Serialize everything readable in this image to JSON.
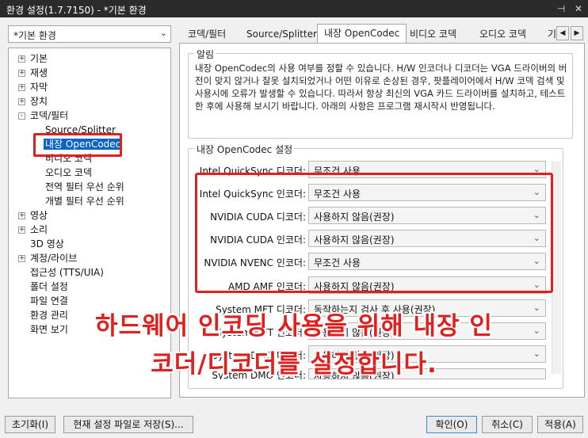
{
  "window": {
    "title": "환경 설정(1.7.7150) - *기본 환경",
    "pin_icon": "pin-icon",
    "close_icon": "close-icon"
  },
  "profile": {
    "selected": "*기본 환경"
  },
  "tree": {
    "items": [
      {
        "label": "기본",
        "expander": "+"
      },
      {
        "label": "재생",
        "expander": "+"
      },
      {
        "label": "자막",
        "expander": "+"
      },
      {
        "label": "장치",
        "expander": "+"
      },
      {
        "label": "코덱/필터",
        "expander": "-"
      },
      {
        "label": "Source/Splitter"
      },
      {
        "label": "내장 OpenCodec"
      },
      {
        "label": "비디오 코덱"
      },
      {
        "label": "오디오 코덱"
      },
      {
        "label": "전역 필터 우선 순위"
      },
      {
        "label": "개별 필터 우선 순위"
      },
      {
        "label": "영상",
        "expander": "+"
      },
      {
        "label": "소리",
        "expander": "+"
      },
      {
        "label": "3D 영상"
      },
      {
        "label": "계정/라이브",
        "expander": "+"
      },
      {
        "label": "접근성 (TTS/UIA)"
      },
      {
        "label": "폴더 설정"
      },
      {
        "label": "파일 연결"
      },
      {
        "label": "환경 관리"
      },
      {
        "label": "화면 보기"
      }
    ]
  },
  "tabs": [
    "코덱/필터",
    "Source/Splitter",
    "내장 OpenCodec",
    "비디오 코덱",
    "오디오 코덱",
    "기"
  ],
  "active_tab": "내장 OpenCodec",
  "notice": {
    "title": "알림",
    "text": "내장 OpenCodec의 사용 여부를 정할 수 있습니다. H/W 인코더나 디코더는 VGA 드라이버의 버전이 맞지 않거나 잘못 설치되었거나 어떤 이유로 손상된 경우, 팟플레이어에서 H/W 코덱 검색 및 사용시에 오류가 발생할 수 있습니다. 따라서 항상 최신의 VGA 카드 드라이버를 설치하고, 테스트한 후에 사용해 보시기 바랍니다. 아래의 사항은 프로그램 재시작시 반영됩니다."
  },
  "codec_settings": {
    "title": "내장 OpenCodec 설정",
    "rows": [
      {
        "label": "Intel QuickSync 디코더:",
        "value": "무조건 사용"
      },
      {
        "label": "Intel QuickSync 인코더:",
        "value": "무조건 사용"
      },
      {
        "label": "NVIDIA CUDA 디코더:",
        "value": "사용하지 않음(권장)"
      },
      {
        "label": "NVIDIA CUDA 인코더:",
        "value": "사용하지 않음(권장)"
      },
      {
        "label": "NVIDIA NVENC 인코더:",
        "value": "무조건 사용"
      },
      {
        "label": "AMD AMF 인코더:",
        "value": "사용하지 않음(권장)"
      },
      {
        "label": "System MFT 디코더:",
        "value": "동작하는지 검사 후 사용(권장)"
      },
      {
        "label": "System MFT 인코더:",
        "value": "사용하지 않음(권장)"
      },
      {
        "label": "System DMO 디코더:",
        "value": "사용하지 않음(권장)"
      },
      {
        "label": "System DMO 인코더:",
        "value": "사용하지 않음(권장)"
      }
    ]
  },
  "overlay": {
    "line1": "하드웨어 인코딩 사용을 위해 내장 인",
    "line2": "코더/디코더를 설정합니다."
  },
  "buttons": {
    "reset": "초기화(I)",
    "save_to_file": "현재 설정 파일로 저장(S)...",
    "ok": "확인(O)",
    "cancel": "취소(C)",
    "apply": "적용(A)"
  },
  "colors": {
    "highlight": "#e0201e",
    "selection": "#0a64c8",
    "titlebar": "#2b2b2b"
  }
}
